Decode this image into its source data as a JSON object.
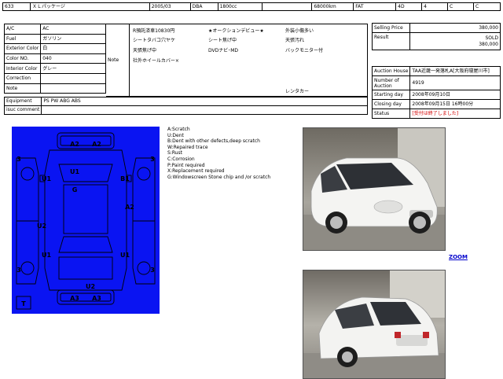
{
  "top_row": [
    "633",
    "ＸＬパッケージ",
    "2005/03",
    "DBA",
    "1800cc",
    "",
    "68000km",
    "FAT",
    "4D",
    "4",
    "C",
    "C"
  ],
  "spec": [
    {
      "label": "A/C",
      "value": "AC"
    },
    {
      "label": "Fuel",
      "value": "ガソリン"
    },
    {
      "label": "Exterior Color",
      "value": "白"
    },
    {
      "label": "Color NO.",
      "value": "040"
    },
    {
      "label": "Interior Color",
      "value": "グレー"
    },
    {
      "label": "Correction",
      "value": ""
    },
    {
      "label": "Note",
      "value": ""
    }
  ],
  "equipment": {
    "label": "Equipment",
    "value": "PS PW ABG ABS"
  },
  "isuc": {
    "label": "isuc comment",
    "value": ""
  },
  "note": {
    "label": "Note",
    "lines": [
      "R預託済車10830円",
      "★オークションデビュー★",
      "外装小傷多い",
      "シートタバコ穴ヤケ",
      "シート焦げ中",
      "天張汚れ",
      "天張焦げ中",
      "DVDナビ･MD",
      "バックモニター付",
      "社外ホイールカバー×",
      "レンタカー"
    ]
  },
  "selling": [
    {
      "label": "Selling Price",
      "value": "380,000"
    },
    {
      "label": "Result",
      "value": "SOLD",
      "value2": "380,000"
    }
  ],
  "auction": [
    {
      "label": "Auction House",
      "value": "TAA近畿一発落札A[大阪府寝屋川市]"
    },
    {
      "label": "Number of Auction",
      "value": "4919"
    },
    {
      "label": "Starting day",
      "value": "2008年09月10日"
    },
    {
      "label": "Closing day",
      "value": "2008年09月15日 16時00分"
    },
    {
      "label": "Status",
      "value": "[受付は終了しました]"
    }
  ],
  "diagram": {
    "marks": [
      "A2",
      "A2",
      "3",
      "3",
      "U1",
      "U1",
      "B1",
      "G",
      "A2",
      "U2",
      "3",
      "3",
      "U1",
      "U1",
      "U2",
      "A3",
      "A3",
      "T"
    ]
  },
  "legend": [
    "A:Scratch",
    "U:Dent",
    "B:Dent with other defects,deep scratch",
    "W:Repaired trace",
    "S:Rust",
    "C:Corrosion",
    "P:Paint required",
    "X:Replacement required",
    "G:Windowscreen Stone chip and /or scratch"
  ],
  "zoom": "ZOOM",
  "colors": {
    "diagram_bg": "#0a14f2",
    "status_red": "#d40000",
    "link": "#0000cc"
  }
}
